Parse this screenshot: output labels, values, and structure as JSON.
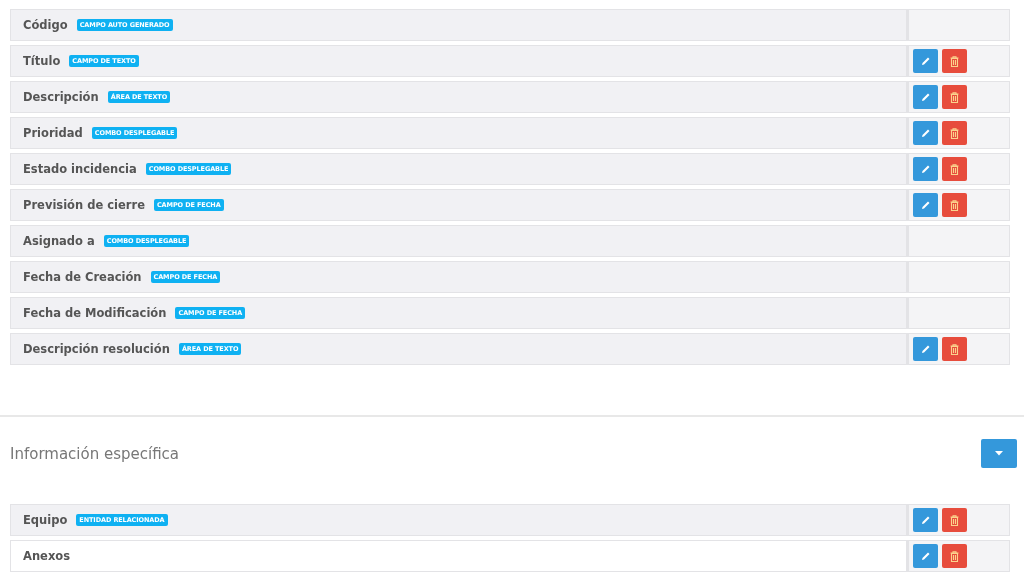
{
  "fields": [
    {
      "label": "Código",
      "badge": "CAMPO AUTO GENERADO",
      "editable": false,
      "shaded": true
    },
    {
      "label": "Título",
      "badge": "CAMPO DE TEXTO",
      "editable": true,
      "shaded": true
    },
    {
      "label": "Descripción",
      "badge": "ÁREA DE TEXTO",
      "editable": true,
      "shaded": true
    },
    {
      "label": "Prioridad",
      "badge": "COMBO DESPLEGABLE",
      "editable": true,
      "shaded": true
    },
    {
      "label": "Estado incidencia",
      "badge": "COMBO DESPLEGABLE",
      "editable": true,
      "shaded": true
    },
    {
      "label": "Previsión de cierre",
      "badge": "CAMPO DE FECHA",
      "editable": true,
      "shaded": true
    },
    {
      "label": "Asignado a",
      "badge": "COMBO DESPLEGABLE",
      "editable": false,
      "shaded": true
    },
    {
      "label": "Fecha de Creación",
      "badge": "CAMPO DE FECHA",
      "editable": false,
      "shaded": true
    },
    {
      "label": "Fecha de Modificación",
      "badge": "CAMPO DE FECHA",
      "editable": false,
      "shaded": true
    },
    {
      "label": "Descripción resolución",
      "badge": "ÁREA DE TEXTO",
      "editable": true,
      "shaded": true
    }
  ],
  "section": {
    "title": "Información específica",
    "fields": [
      {
        "label": "Equipo",
        "badge": "ENTIDAD RELACIONADA",
        "editable": true,
        "shaded": true
      },
      {
        "label": "Anexos",
        "editable": true,
        "shaded": false
      }
    ]
  }
}
